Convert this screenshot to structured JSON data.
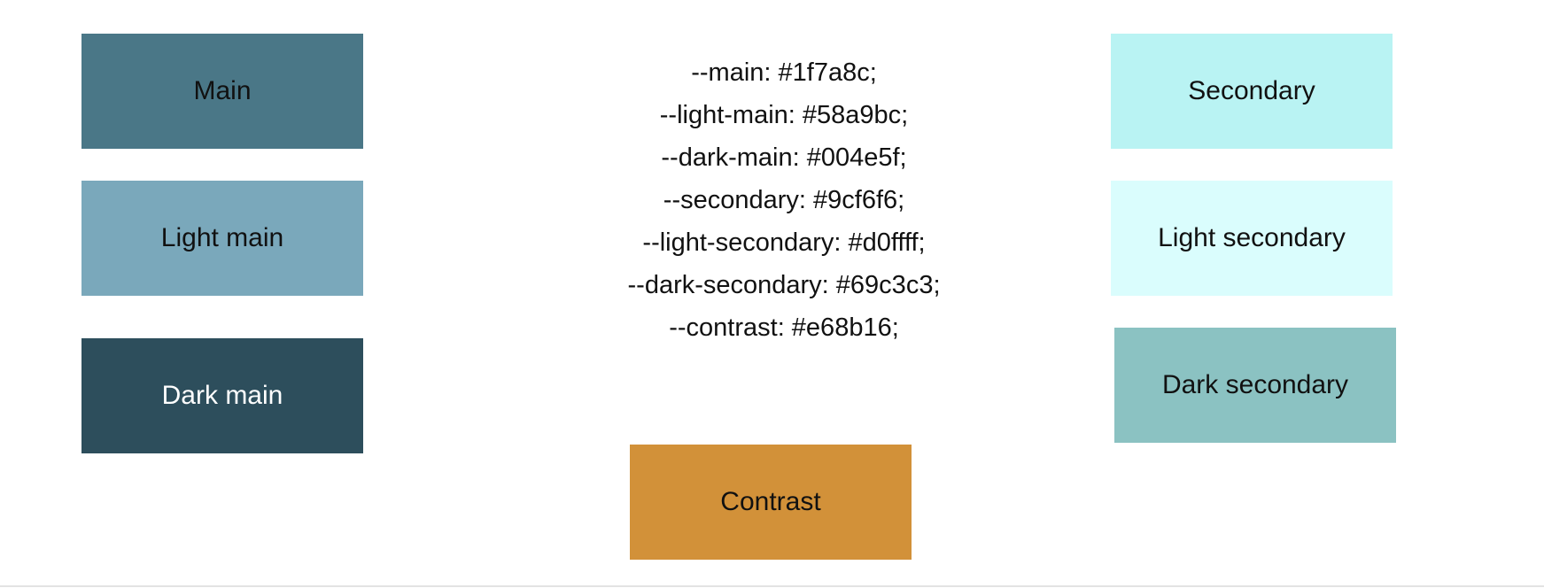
{
  "swatches": {
    "main": {
      "label": "Main",
      "color": "#4a7787"
    },
    "light_main": {
      "label": "Light main",
      "color": "#7aa8bb"
    },
    "dark_main": {
      "label": "Dark main",
      "color": "#2d4e5c"
    },
    "secondary": {
      "label": "Secondary",
      "color": "#b9f3f3"
    },
    "light_secondary": {
      "label": "Light secondary",
      "color": "#dafdfd"
    },
    "dark_secondary": {
      "label": "Dark secondary",
      "color": "#8bc2c2"
    },
    "contrast": {
      "label": "Contrast",
      "color": "#d29139"
    }
  },
  "css_variables": [
    "--main: #1f7a8c;",
    "--light-main: #58a9bc;",
    "--dark-main: #004e5f;",
    "--secondary: #9cf6f6;",
    "--light-secondary: #d0ffff;",
    "--dark-secondary: #69c3c3;",
    "--contrast: #e68b16;"
  ]
}
